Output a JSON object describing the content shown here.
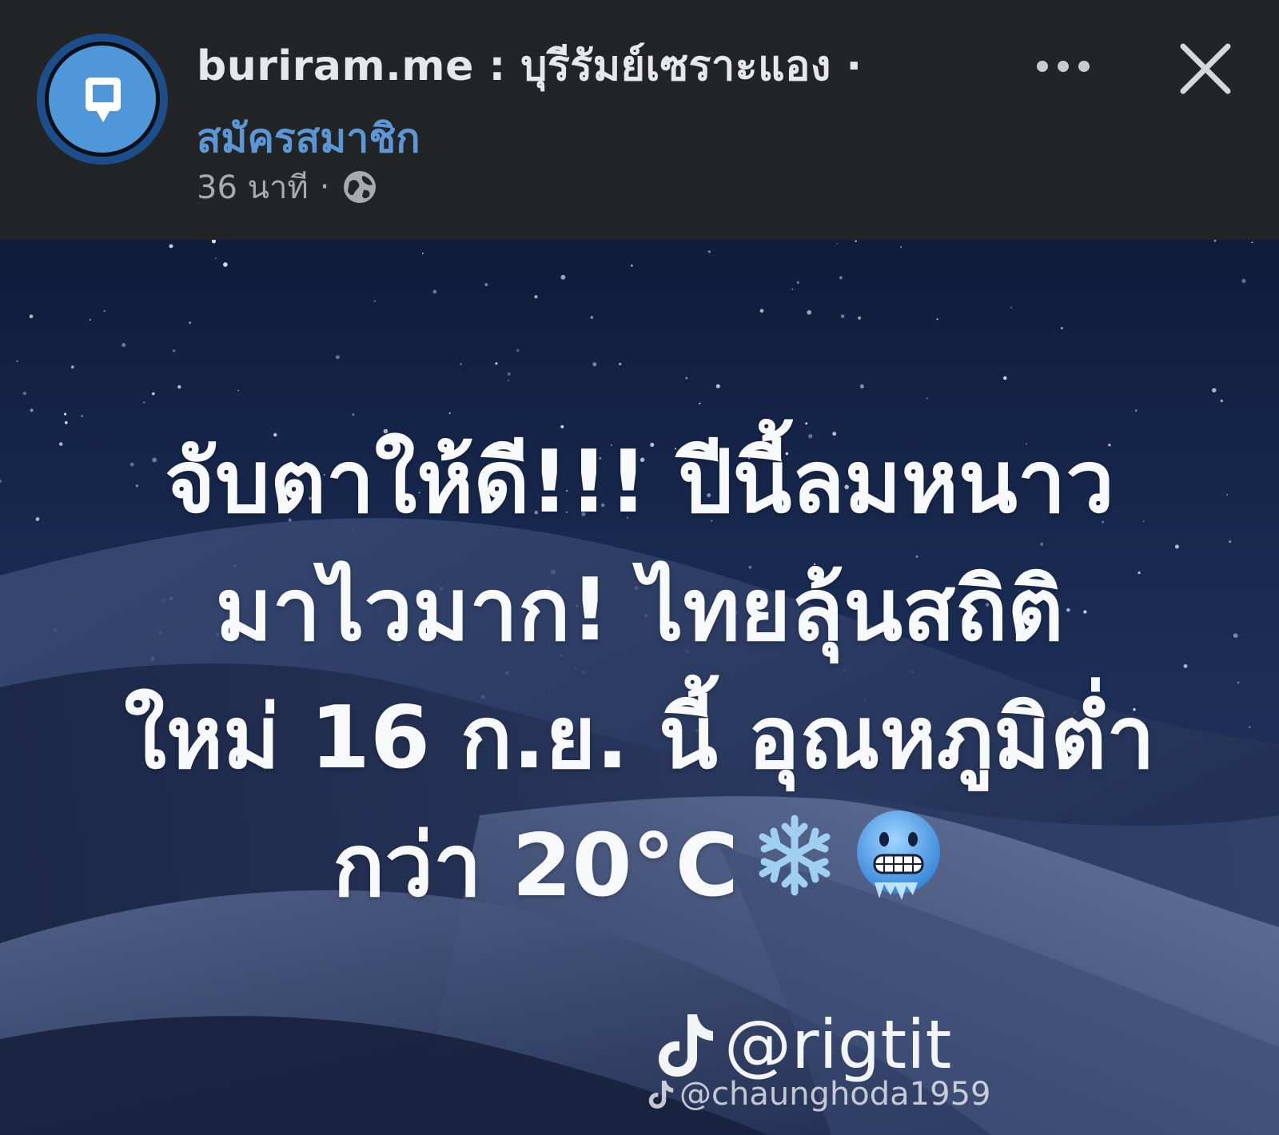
{
  "header": {
    "page_name": "buriram.me : บุรีรัมย์เซราะแอง ·",
    "subscribe_label": "สมัครสมาชิก",
    "time_ago": "36 นาที",
    "separator": "·",
    "icons": {
      "avatar": "map-pin-logo-icon",
      "privacy": "globe-icon",
      "more": "more-options-icon",
      "close": "close-icon"
    }
  },
  "post": {
    "headline_lines": [
      "จับตาให้ดี!!! ปีนี้ลมหนาว",
      "มาไวมาก! ไทยลุ้นสถิติ",
      "ใหม่ 16 ก.ย. นี้ อุณหภูมิต่ำ",
      "กว่า 20°C"
    ],
    "headline_emojis": [
      "snowflake-emoji",
      "cold-face-emoji"
    ],
    "tiktok_handle": "@rigtit",
    "watermark": "@chaunghoda1959"
  },
  "colors": {
    "header_bg": "#232425",
    "link_blue": "#5b97d6",
    "avatar_blue": "#4f97d8",
    "night_sky": "#1a2a4d",
    "headline_text": "#f8f9fb"
  }
}
